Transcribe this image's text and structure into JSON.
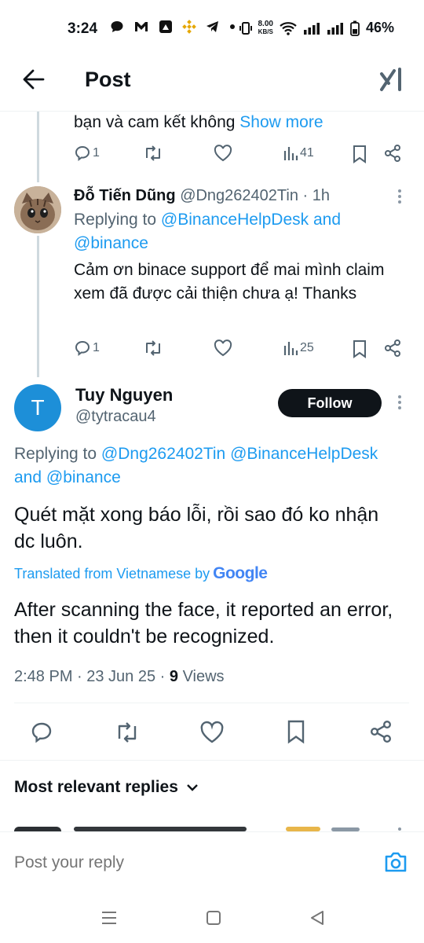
{
  "status": {
    "time": "3:24",
    "netspeed_value": "8.00",
    "netspeed_unit": "KB/S",
    "battery": "46%"
  },
  "header": {
    "title": "Post"
  },
  "tweet_prev": {
    "text_tail": "bạn và cam kết không ",
    "show_more": "Show more",
    "reply_count": "1",
    "views": "41"
  },
  "tweet_reply": {
    "name": "Đỗ Tiến Dũng",
    "handle": "@Dng262402Tin",
    "time": "· 1h",
    "replying_prefix": "Replying to ",
    "replying_1": "@BinanceHelpDesk",
    "replying_and": " and",
    "replying_2": "@binance",
    "text": "Cảm ơn binace support để mai mình claim xem đã được cải thiện chưa ạ! Thanks",
    "reply_count": "1",
    "views": "25"
  },
  "main_tweet": {
    "avatar_letter": "T",
    "avatar_color": "#1d8fd8",
    "name": "Tuy Nguyen",
    "handle": "@tytracau4",
    "follow_label": "Follow",
    "replying_prefix": "Replying to ",
    "replying_1": "@Dng262402Tin",
    "replying_2": "@BinanceHelpDesk",
    "replying_and": "and ",
    "replying_3": "@binance",
    "text": "Quét mặt xong báo lỗi, rồi sao đó ko nhận dc luôn.",
    "translated_label": "Translated from Vietnamese by",
    "google": "Google",
    "translation": "After scanning the face, it reported an error, then it couldn't be recognized.",
    "timestamp": "2:48 PM · 23 Jun 25 · ",
    "views_count": "9",
    "views_label": " Views"
  },
  "replies_header": {
    "label": "Most relevant replies"
  },
  "compose": {
    "placeholder": "Post your reply"
  },
  "colors": {
    "accent": "#1d9bf0",
    "text": "#0f1419",
    "secondary": "#536471"
  }
}
